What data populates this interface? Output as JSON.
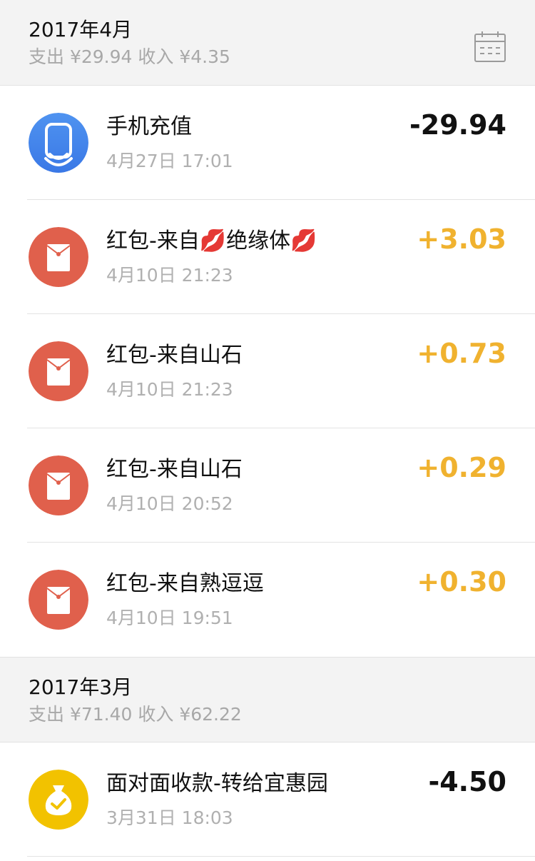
{
  "months": [
    {
      "title": "2017年4月",
      "summary": "支出 ¥29.94 收入 ¥4.35",
      "transactions": [
        {
          "title": "手机充值",
          "time": "4月27日 17:01",
          "amount": "-29.94",
          "icon": "phone-recharge-icon"
        },
        {
          "title": "红包-来自💋绝缘体💋",
          "time": "4月10日 21:23",
          "amount": "+3.03",
          "icon": "red-packet-icon"
        },
        {
          "title": "红包-来自山石",
          "time": "4月10日 21:23",
          "amount": "+0.73",
          "icon": "red-packet-icon"
        },
        {
          "title": "红包-来自山石",
          "time": "4月10日 20:52",
          "amount": "+0.29",
          "icon": "red-packet-icon"
        },
        {
          "title": "红包-来自熟逗逗",
          "time": "4月10日 19:51",
          "amount": "+0.30",
          "icon": "red-packet-icon"
        }
      ]
    },
    {
      "title": "2017年3月",
      "summary": "支出 ¥71.40 收入 ¥62.22",
      "transactions": [
        {
          "title": "面对面收款-转给宜惠园",
          "time": "3月31日 18:03",
          "amount": "-4.50",
          "icon": "money-bag-icon"
        }
      ]
    }
  ],
  "colors": {
    "header_bg": "#f3f3f3",
    "income": "#f0b22f",
    "expense": "#111111",
    "red_packet": "#e0604c",
    "money_bag": "#f2c200",
    "recharge_blue": "#3f86ea"
  }
}
